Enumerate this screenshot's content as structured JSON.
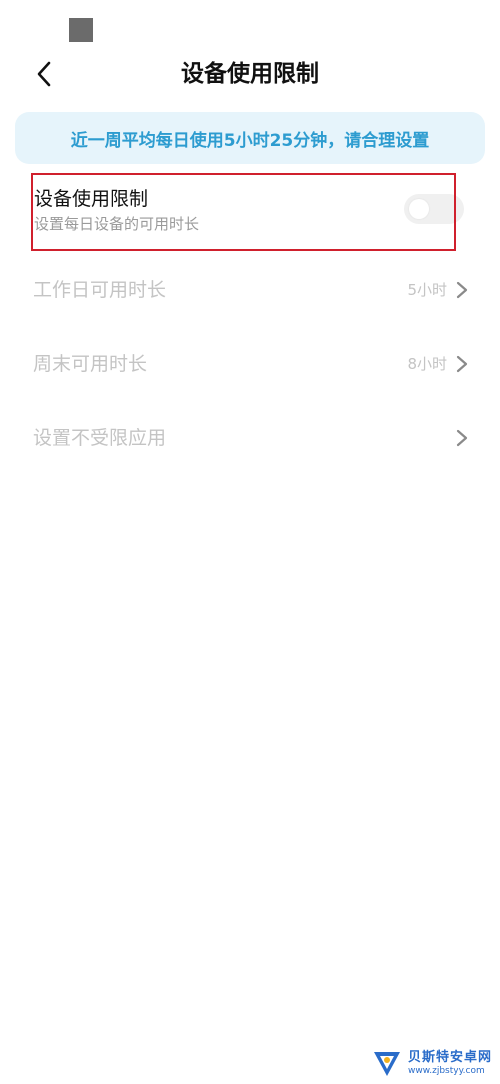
{
  "header": {
    "title": "设备使用限制"
  },
  "banner": {
    "text": "近一周平均每日使用5小时25分钟，请合理设置"
  },
  "device_limit": {
    "title": "设备使用限制",
    "subtitle": "设置每日设备的可用时长",
    "enabled": false
  },
  "settings": [
    {
      "label": "工作日可用时长",
      "value": "5小时"
    },
    {
      "label": "周末可用时长",
      "value": "8小时"
    },
    {
      "label": "设置不受限应用",
      "value": ""
    }
  ],
  "colors": {
    "accent": "#2d9cd0",
    "banner_bg": "#e6f4fb",
    "highlight": "#d0202d",
    "disabled_text": "#c4c4c4"
  },
  "watermark": {
    "name": "贝斯特安卓网",
    "url": "www.zjbstyy.com"
  }
}
